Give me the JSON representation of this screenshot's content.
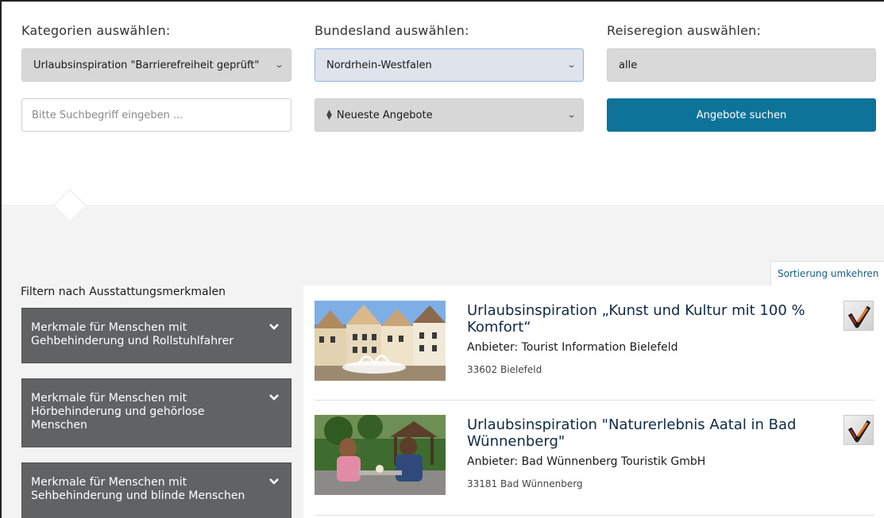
{
  "search": {
    "category_label": "Kategorien auswählen:",
    "category_value": "Urlaubsinspiration \"Barrierefreiheit geprüft\"",
    "state_label": "Bundesland auswählen:",
    "state_value": "Nordrhein-Westfalen",
    "region_label": "Reiseregion auswählen:",
    "region_value": "alle",
    "query_placeholder": "Bitte Suchbegriff eingeben ...",
    "sort_value": "Neueste Angebote",
    "submit_label": "Angebote suchen"
  },
  "sort_toggle_label": "Sortierung umkehren",
  "filters": {
    "heading": "Filtern nach Ausstattungsmerkmalen",
    "items": [
      {
        "label": "Merkmale für Menschen mit Gehbehinderung und Rollstuhlfahrer"
      },
      {
        "label": "Merkmale für Menschen mit Hörbehinderung und gehörlose Menschen"
      },
      {
        "label": "Merkmale für Menschen mit Sehbehinderung und blinde Menschen"
      }
    ]
  },
  "results": [
    {
      "title": "Urlaubsinspiration „Kunst und Kultur mit 100 % Komfort“",
      "provider": "Anbieter: Tourist Information Bielefeld",
      "location": "33602 Bielefeld",
      "thumb_icon": "town-square-fountain-photo",
      "badge_icon": "checkmark-certificate-icon"
    },
    {
      "title": "Urlaubsinspiration \"Naturerlebnis Aatal in Bad Wünnenberg\"",
      "provider": "Anbieter: Bad Wünnenberg Touristik GmbH",
      "location": "33181 Bad Wünnenberg",
      "thumb_icon": "couple-picnic-photo",
      "badge_icon": "checkmark-certificate-icon"
    }
  ],
  "colors": {
    "accent": "#0e7398",
    "accordion_bg": "#606264",
    "sort_link": "#155e83"
  }
}
